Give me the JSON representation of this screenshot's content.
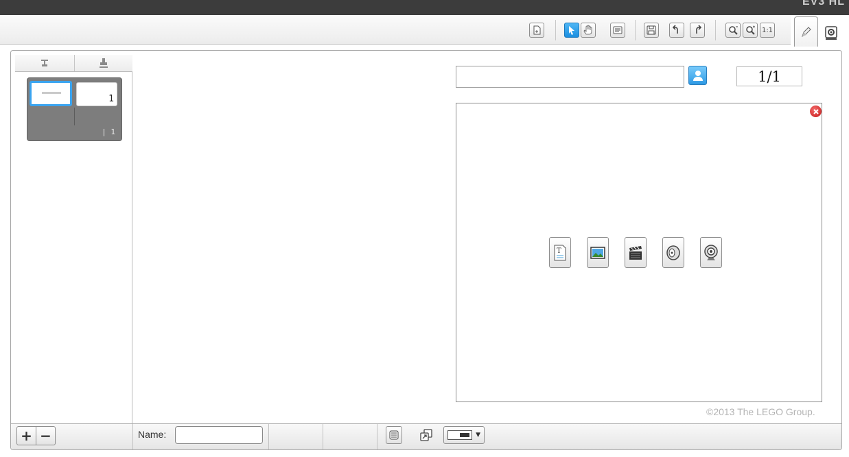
{
  "app": {
    "brand": "EV3 HL"
  },
  "toolbar": {
    "buttons": [
      {
        "name": "new-page-button",
        "icon": "new-page-icon"
      },
      {
        "name": "select-tool-button",
        "icon": "arrow-cursor-icon",
        "active": true
      },
      {
        "name": "pan-tool-button",
        "icon": "hand-icon"
      },
      {
        "name": "comment-tool-button",
        "icon": "comment-icon"
      },
      {
        "name": "save-button",
        "icon": "floppy-icon"
      },
      {
        "name": "undo-button",
        "icon": "undo-icon"
      },
      {
        "name": "redo-button",
        "icon": "redo-icon"
      },
      {
        "name": "zoom-out-button",
        "icon": "zoom-out-icon"
      },
      {
        "name": "zoom-in-button",
        "icon": "zoom-in-icon"
      },
      {
        "name": "zoom-reset-button",
        "label": "1:1"
      }
    ],
    "side_tabs": [
      {
        "name": "edit-tab",
        "icon": "pencil-icon"
      },
      {
        "name": "settings-tab",
        "icon": "gear-icon"
      }
    ]
  },
  "left_panel": {
    "tabs": [
      {
        "name": "tab-pages",
        "icon": "anvil-icon"
      },
      {
        "name": "tab-stamps",
        "icon": "stamp-icon"
      }
    ],
    "page_card": {
      "thumb_number": "1",
      "footer": "| 1"
    }
  },
  "content": {
    "search_placeholder": "",
    "page_count": "1/1"
  },
  "media_buttons": [
    {
      "name": "insert-text-button",
      "icon": "text-document-icon"
    },
    {
      "name": "insert-image-button",
      "icon": "image-icon"
    },
    {
      "name": "insert-video-button",
      "icon": "clapperboard-icon"
    },
    {
      "name": "insert-sound-button",
      "icon": "speaker-icon"
    },
    {
      "name": "insert-camera-button",
      "icon": "webcam-icon"
    }
  ],
  "footer": {
    "copyright": "©2013 The LEGO Group.",
    "add_label": "+",
    "remove_label": "−",
    "name_label": "Name:",
    "name_value": ""
  }
}
